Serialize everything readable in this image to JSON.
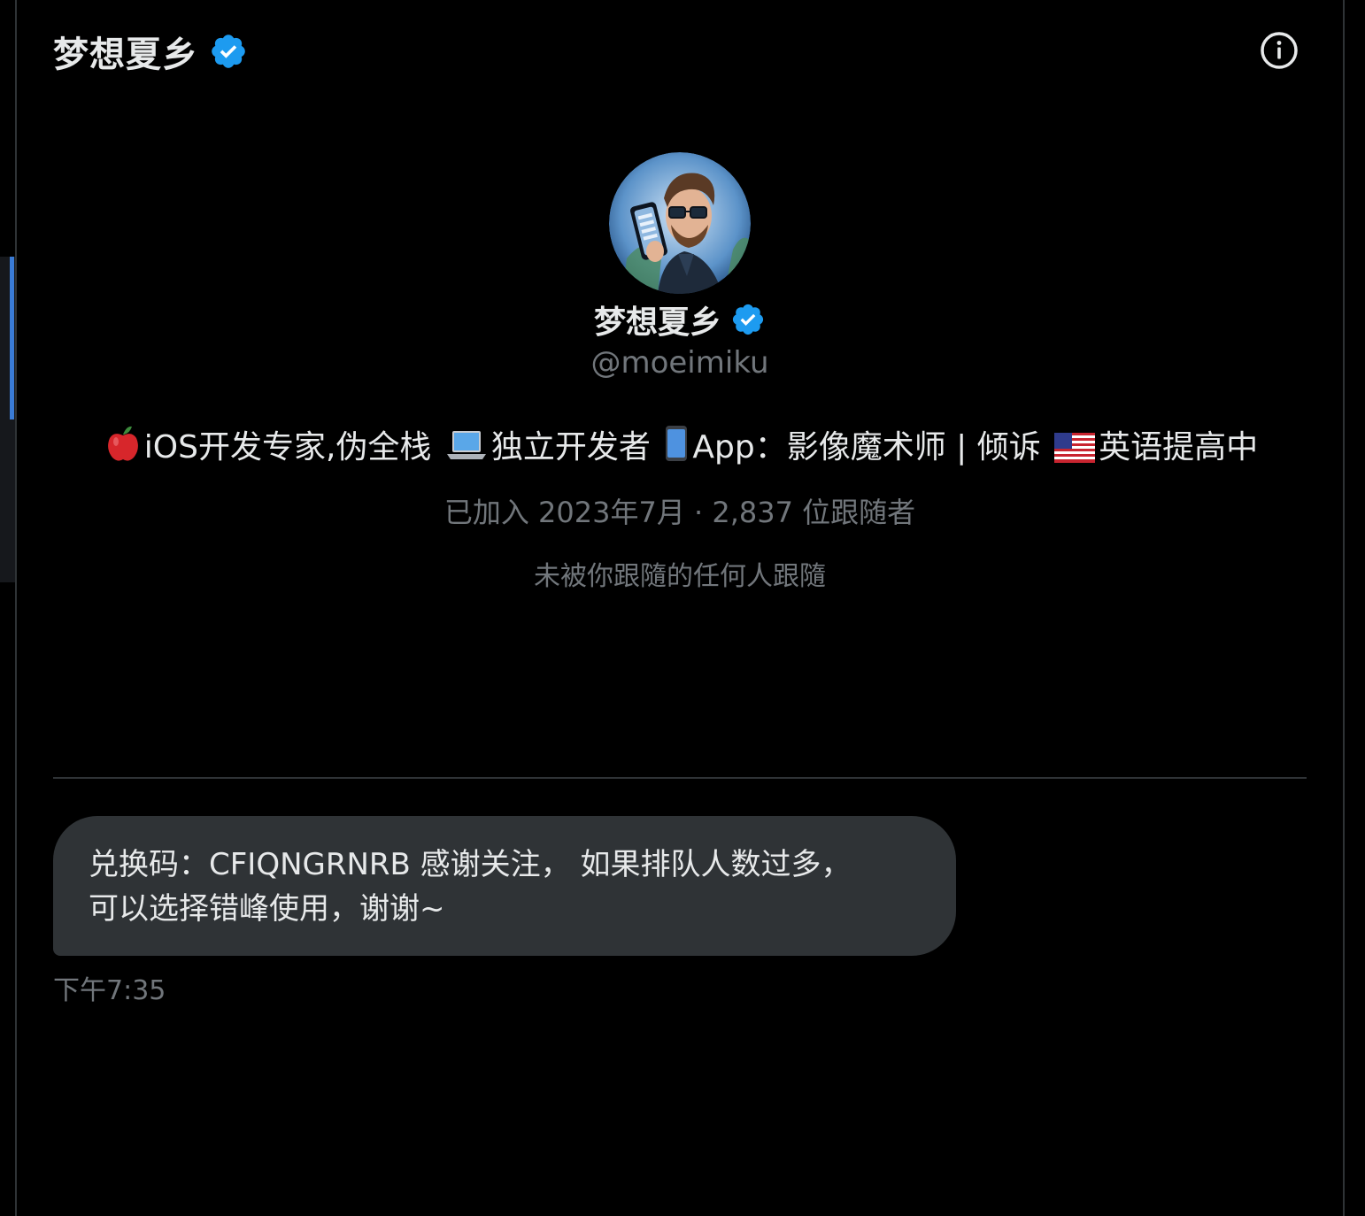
{
  "header": {
    "title": "梦想夏乡",
    "verified_icon": "verified-badge-icon",
    "info_icon": "info-icon"
  },
  "profile": {
    "name": "梦想夏乡",
    "handle": "@moeimiku",
    "bio_parts": {
      "p1": "iOS开发专家,伪全栈",
      "p2": "独立开发者",
      "p3": "App：影像魔术师 | 倾诉",
      "p4": "英语提高中"
    },
    "bio_emojis": [
      "apple-emoji",
      "laptop-emoji",
      "phone-emoji",
      "us-flag-emoji"
    ],
    "joined": "已加入 2023年7月",
    "dot": " · ",
    "followers": "2,837 位跟随者",
    "not_followed": "未被你跟隨的任何人跟隨"
  },
  "message": {
    "line1": "兑换码：CFIQNGRNRB 感谢关注， 如果排队人数过多，",
    "line2": "可以选择错峰使用，谢谢~",
    "time": "下午7:35"
  },
  "colors": {
    "background": "#000000",
    "text_primary": "#e7e9ea",
    "text_secondary": "#71767b",
    "bubble": "#2f3336",
    "verified": "#1d9bf0",
    "accent": "#3a7bd5"
  }
}
